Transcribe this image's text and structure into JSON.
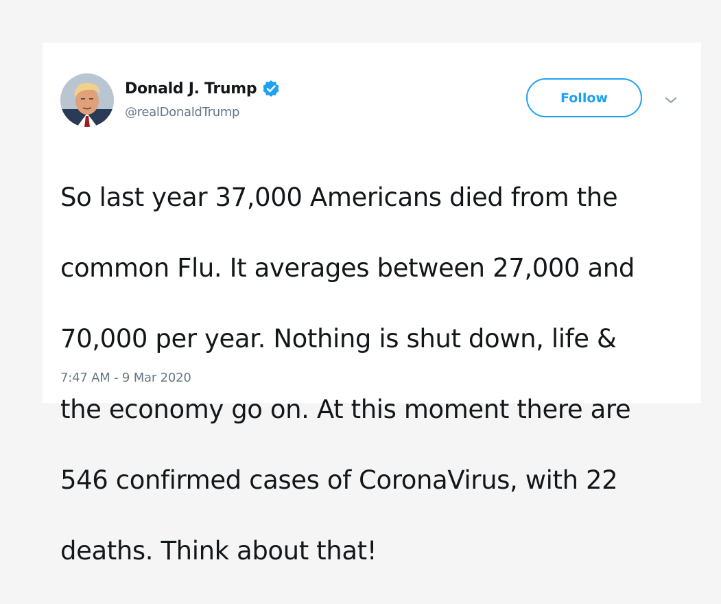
{
  "author": {
    "name": "Donald J. Trump",
    "handle": "@realDonaldTrump",
    "verified": true
  },
  "actions": {
    "follow_label": "Follow"
  },
  "tweet": {
    "lines": [
      "So last year 37,000 Americans died from the",
      "common Flu. It averages between 27,000 and",
      "70,000 per year. Nothing is shut down, life &",
      "the economy go on. At this moment there are",
      "546 confirmed cases of CoronaVirus, with 22",
      "deaths. Think about that!"
    ],
    "timestamp": "7:47 AM - 9 Mar 2020"
  },
  "icons": {
    "verified": "verified-badge-icon",
    "menu": "chevron-down-icon"
  },
  "colors": {
    "accent": "#1da1f2",
    "text": "#14171a",
    "muted": "#657786",
    "background": "#f5f5f5",
    "card": "#ffffff"
  }
}
